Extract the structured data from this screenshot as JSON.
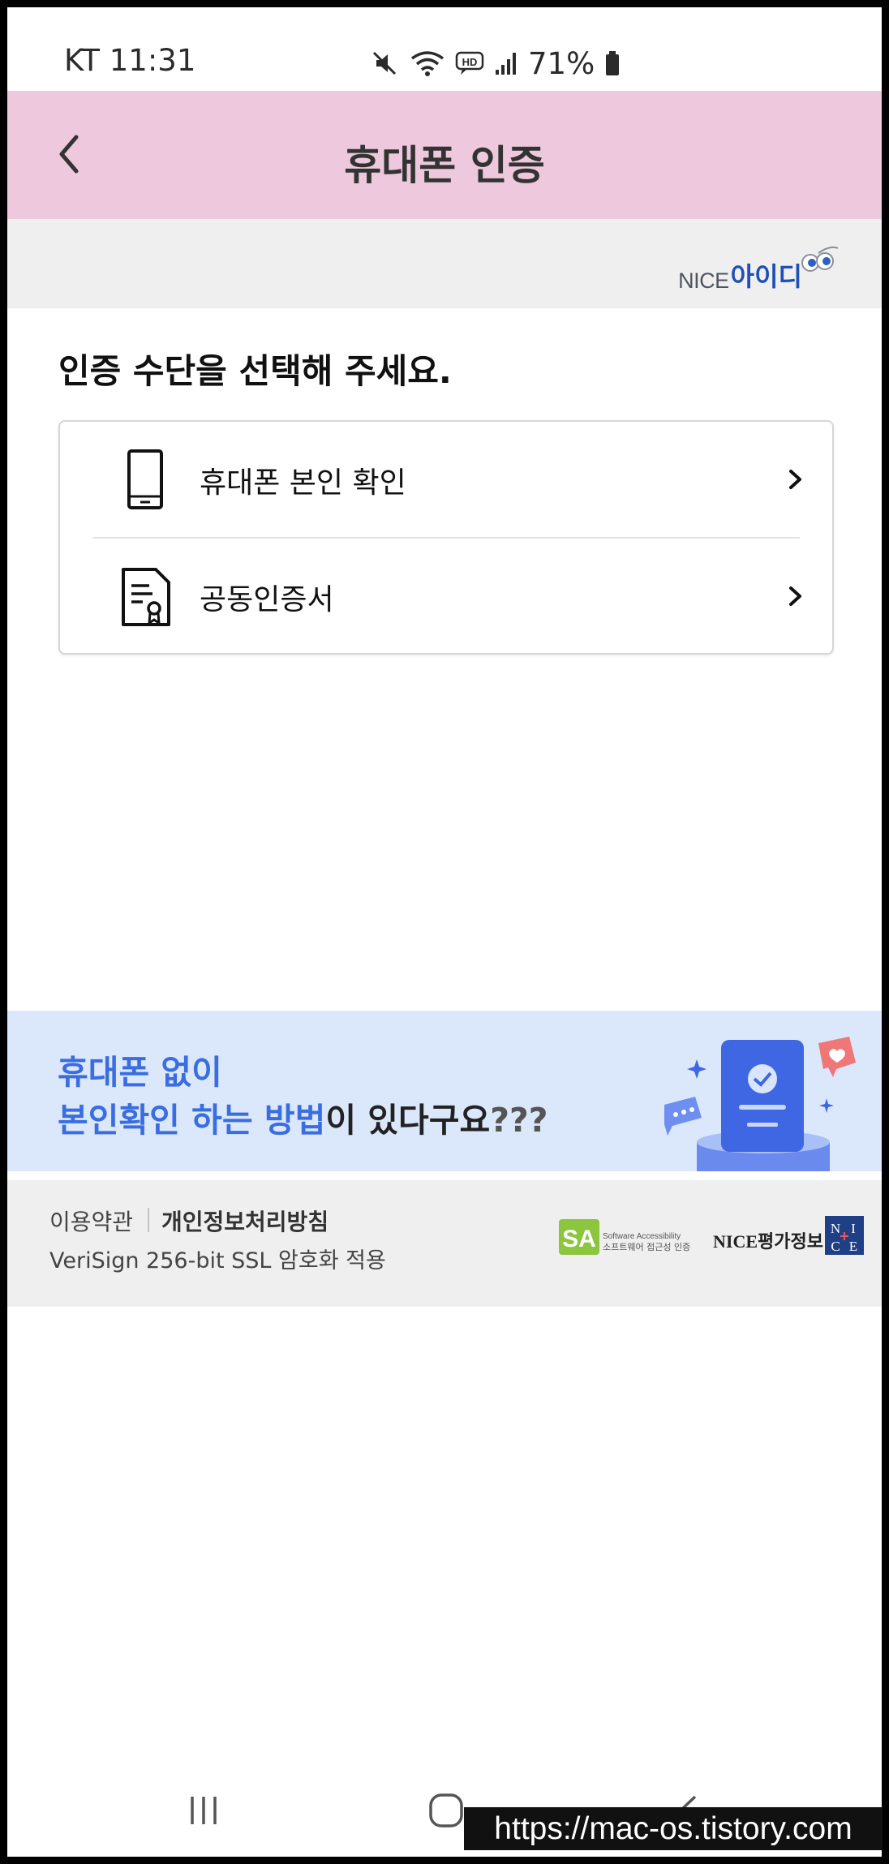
{
  "status_bar": {
    "carrier_time": "KT 11:31",
    "battery": "71%",
    "icons": [
      "mute-icon",
      "wifi-icon",
      "hd-icon",
      "signal-icon",
      "battery-icon"
    ]
  },
  "header": {
    "title": "휴대폰 인증",
    "back_icon": "chevron-left-icon",
    "background": "#eec9de"
  },
  "brand": {
    "logo_latin": "NICE",
    "logo_korean": "아이디"
  },
  "main": {
    "prompt": "인증 수단을 선택해 주세요.",
    "methods": [
      {
        "label": "휴대폰 본인 확인",
        "icon": "smartphone-icon"
      },
      {
        "label": "공동인증서",
        "icon": "certificate-icon"
      }
    ]
  },
  "banner": {
    "line1": "휴대폰 없이",
    "line2_highlight": "본인확인 하는 방법",
    "line2_rest": "이 있다구요",
    "line2_marks": "???",
    "background": "#dbe7fb",
    "accent": "#3a6ee0"
  },
  "footer": {
    "terms": "이용약관",
    "privacy": "개인정보처리방침",
    "ssl": "VeriSign 256-bit SSL 암호화 적용",
    "sa_logo_title": "SA",
    "sa_logo_caption": "Software Accessibility",
    "sa_logo_caption_ko": "소프트웨어 접근성 인증",
    "rating_company": "NICE평가정보",
    "nice_box_letters": [
      "N",
      "I",
      "C",
      "E"
    ]
  },
  "watermark": "https://mac-os.tistory.com"
}
